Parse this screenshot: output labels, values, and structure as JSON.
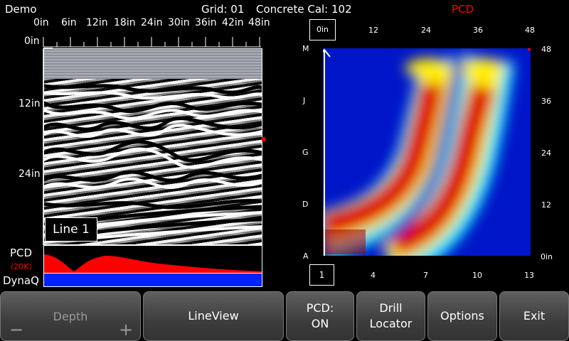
{
  "header": {
    "mode": "Demo",
    "grid": "Grid: 01",
    "calibration": "Concrete Cal: 102",
    "pcd_title": "PCD"
  },
  "scan": {
    "x_ruler": [
      "0in",
      "6in",
      "12in",
      "18in",
      "24in",
      "30in",
      "36in",
      "42in",
      "48in"
    ],
    "y_ruler": [
      "0in",
      "12in",
      "24in"
    ],
    "line_label": "Line 1"
  },
  "pcd_panel": {
    "label": "PCD",
    "gain": "(20K)",
    "dynaq_label": "DynaQ",
    "fill_color": "#ff0000",
    "dynaq_color": "#0022ff"
  },
  "heatmap": {
    "top_axis": [
      "0in",
      "12",
      "24",
      "36",
      "48"
    ],
    "bottom_axis": [
      "1",
      "4",
      "7",
      "10",
      "13"
    ],
    "left_axis": [
      "M",
      "J",
      "G",
      "D",
      "A"
    ],
    "right_axis": [
      "48",
      "36",
      "24",
      "12",
      "0in"
    ]
  },
  "buttons": {
    "depth": "Depth",
    "depth_minus": "−",
    "depth_plus": "+",
    "lineview": "LineView",
    "pcd_line1": "PCD:",
    "pcd_line2": "ON",
    "drill_line1": "Drill",
    "drill_line2": "Locator",
    "options": "Options",
    "exit": "Exit"
  }
}
